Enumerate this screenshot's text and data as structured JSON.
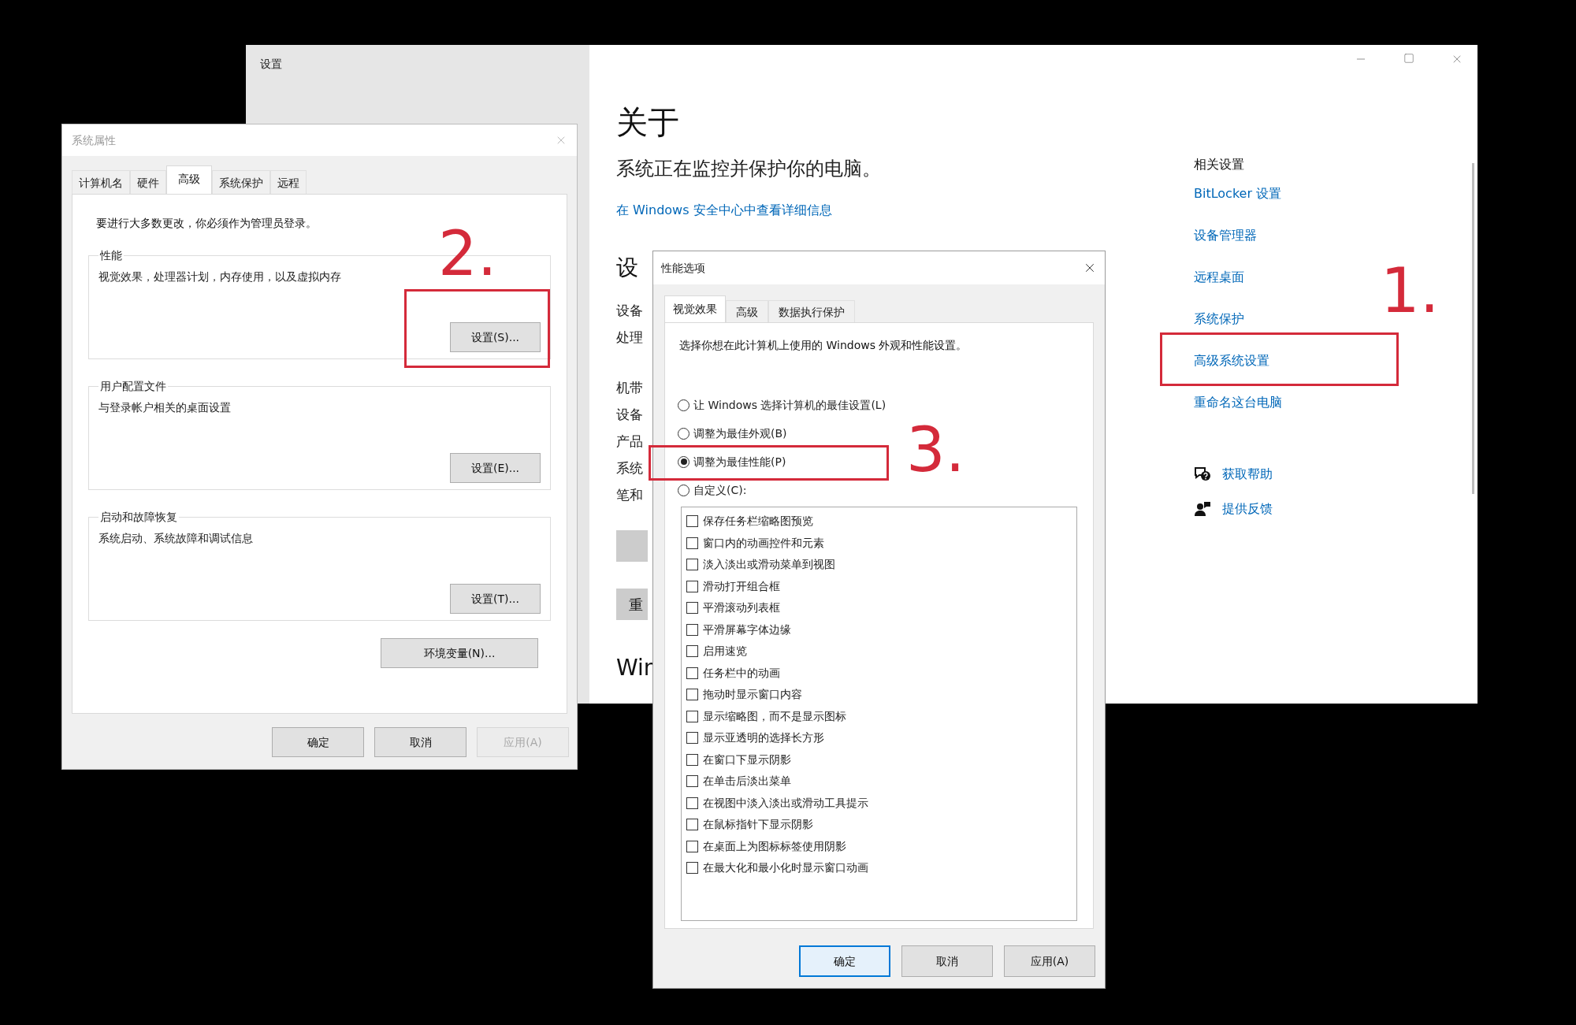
{
  "settings_window": {
    "title": "设置",
    "heading": "关于",
    "status": "系统正在监控并保护你的电脑。",
    "security_link": "在 Windows 安全中心中查看详细信息",
    "device_heading": "设",
    "device_labels": [
      "设备",
      "处理",
      "机带",
      "设备",
      "产品",
      "系统",
      "笔和"
    ],
    "rename_button": "重",
    "windows_heading": "Win",
    "related_title": "相关设置",
    "related_links": [
      "BitLocker 设置",
      "设备管理器",
      "远程桌面",
      "系统保护",
      "高级系统设置",
      "重命名这台电脑"
    ],
    "support_links": [
      {
        "kind": "help",
        "label": "获取帮助"
      },
      {
        "kind": "feedback",
        "label": "提供反馈"
      }
    ]
  },
  "system_properties": {
    "title": "系统属性",
    "tabs": [
      {
        "label": "计算机名",
        "selected": false
      },
      {
        "label": "硬件",
        "selected": false
      },
      {
        "label": "高级",
        "selected": true
      },
      {
        "label": "系统保护",
        "selected": false
      },
      {
        "label": "远程",
        "selected": false
      }
    ],
    "notice": "要进行大多数更改，你必须作为管理员登录。",
    "groups": [
      {
        "title": "性能",
        "description": "视觉效果，处理器计划，内存使用，以及虚拟内存",
        "button": "设置(S)..."
      },
      {
        "title": "用户配置文件",
        "description": "与登录帐户相关的桌面设置",
        "button": "设置(E)..."
      },
      {
        "title": "启动和故障恢复",
        "description": "系统启动、系统故障和调试信息",
        "button": "设置(T)..."
      }
    ],
    "env_button": "环境变量(N)...",
    "buttons": [
      {
        "label": "确定",
        "disabled": false
      },
      {
        "label": "取消",
        "disabled": false
      },
      {
        "label": "应用(A)",
        "disabled": true
      }
    ]
  },
  "performance_options": {
    "title": "性能选项",
    "tabs": [
      {
        "label": "视觉效果",
        "selected": true
      },
      {
        "label": "高级",
        "selected": false
      },
      {
        "label": "数据执行保护",
        "selected": false
      }
    ],
    "description": "选择你想在此计算机上使用的 Windows 外观和性能设置。",
    "radios": [
      {
        "label": "让 Windows 选择计算机的最佳设置(L)",
        "selected": false
      },
      {
        "label": "调整为最佳外观(B)",
        "selected": false
      },
      {
        "label": "调整为最佳性能(P)",
        "selected": true
      },
      {
        "label": "自定义(C):",
        "selected": false
      }
    ],
    "effects": [
      {
        "label": "保存任务栏缩略图预览",
        "checked": false
      },
      {
        "label": "窗口内的动画控件和元素",
        "checked": false
      },
      {
        "label": "淡入淡出或滑动菜单到视图",
        "checked": false
      },
      {
        "label": "滑动打开组合框",
        "checked": false
      },
      {
        "label": "平滑滚动列表框",
        "checked": false
      },
      {
        "label": "平滑屏幕字体边缘",
        "checked": false
      },
      {
        "label": "启用速览",
        "checked": false
      },
      {
        "label": "任务栏中的动画",
        "checked": false
      },
      {
        "label": "拖动时显示窗口内容",
        "checked": false
      },
      {
        "label": "显示缩略图，而不是显示图标",
        "checked": false
      },
      {
        "label": "显示亚透明的选择长方形",
        "checked": false
      },
      {
        "label": "在窗口下显示阴影",
        "checked": false
      },
      {
        "label": "在单击后淡出菜单",
        "checked": false
      },
      {
        "label": "在视图中淡入淡出或滑动工具提示",
        "checked": false
      },
      {
        "label": "在鼠标指针下显示阴影",
        "checked": false
      },
      {
        "label": "在桌面上为图标标签使用阴影",
        "checked": false
      },
      {
        "label": "在最大化和最小化时显示窗口动画",
        "checked": false
      }
    ],
    "buttons": [
      {
        "label": "确定",
        "default": true
      },
      {
        "label": "取消",
        "default": false
      },
      {
        "label": "应用(A)",
        "default": false
      }
    ]
  },
  "annotations": [
    {
      "label": "1."
    },
    {
      "label": "2."
    },
    {
      "label": "3."
    }
  ]
}
